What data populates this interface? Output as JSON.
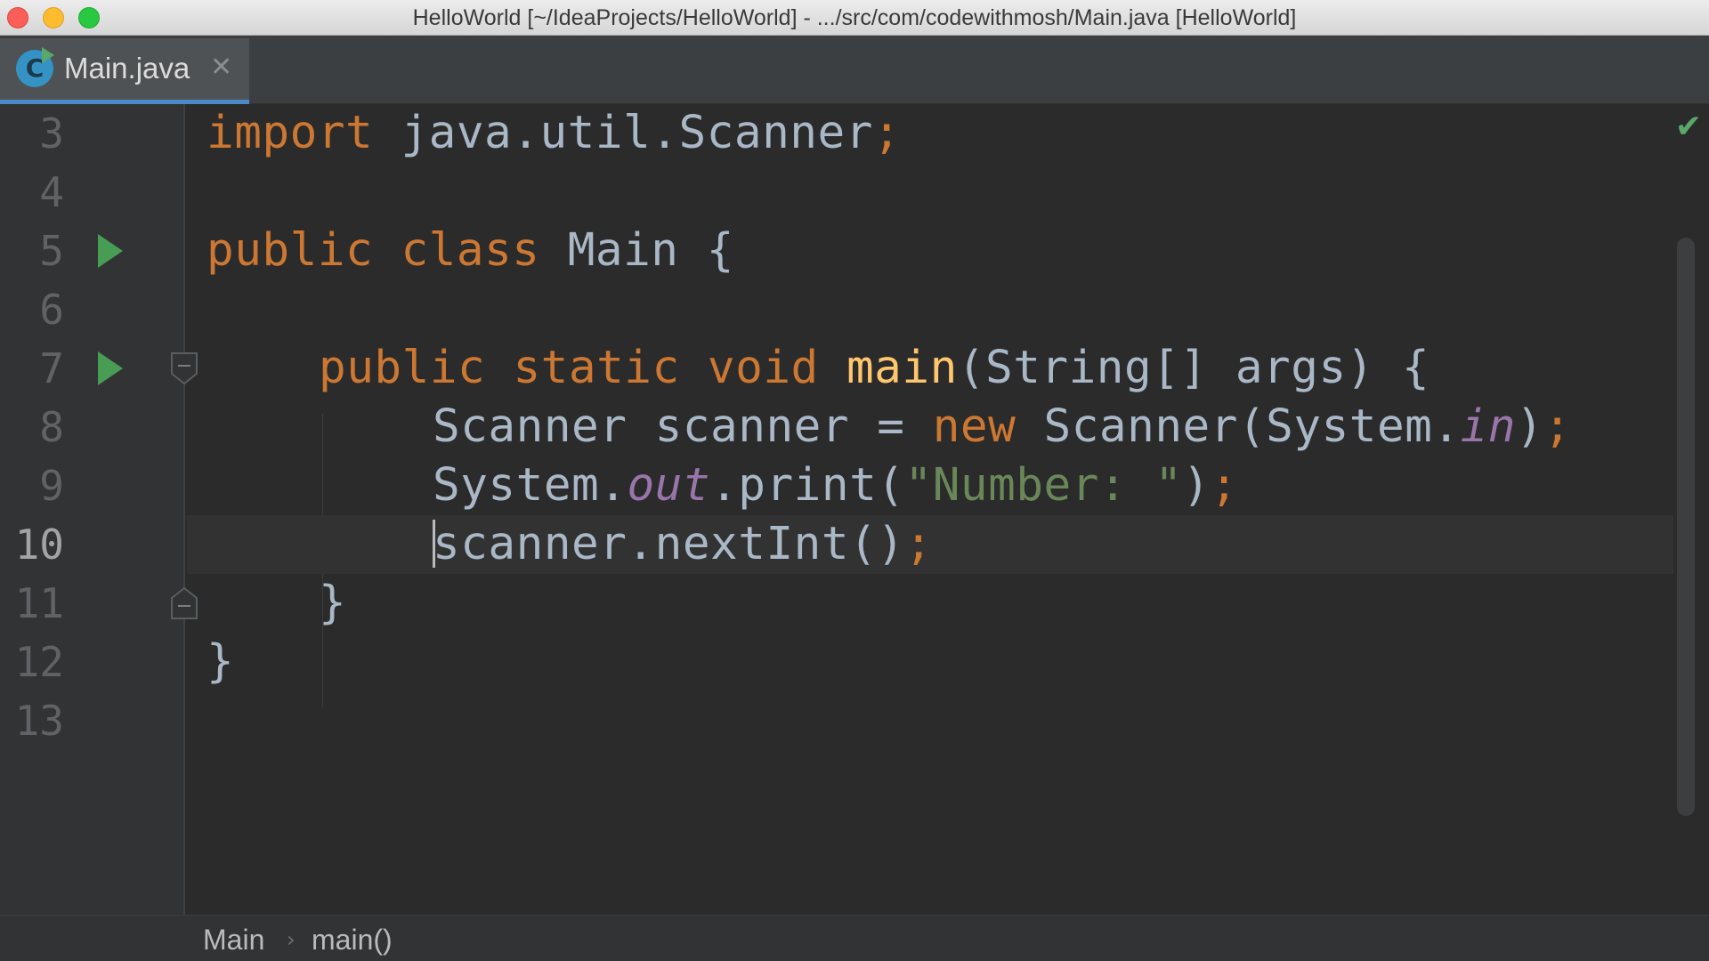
{
  "window": {
    "title": "HelloWorld [~/IdeaProjects/HelloWorld] - .../src/com/codewithmosh/Main.java [HelloWorld]"
  },
  "tabs": [
    {
      "label": "Main.java",
      "icon": "java-class-icon",
      "active": true
    }
  ],
  "editor": {
    "status_icon": "check-icon",
    "lines": [
      {
        "number": "3"
      },
      {
        "number": "4"
      },
      {
        "number": "5"
      },
      {
        "number": "6"
      },
      {
        "number": "7"
      },
      {
        "number": "8"
      },
      {
        "number": "9"
      },
      {
        "number": "10",
        "current": true
      },
      {
        "number": "11"
      },
      {
        "number": "12"
      },
      {
        "number": "13"
      }
    ],
    "tokens": {
      "l3": [
        "import",
        " java.util.Scanner",
        ";"
      ],
      "l5": [
        "public",
        " ",
        "class",
        " Main {"
      ],
      "l7": [
        "public",
        " ",
        "static",
        " ",
        "void",
        " ",
        "main",
        "(String[] args) {"
      ],
      "l8": [
        "Scanner scanner = ",
        "new",
        " Scanner(System.",
        "in",
        ")",
        ";"
      ],
      "l9": [
        "System.",
        "out",
        ".print(",
        "\"Number: \"",
        ")",
        ";"
      ],
      "l10": [
        "scanner.nextInt()",
        ";"
      ],
      "l11": [
        "}"
      ],
      "l12": [
        "}"
      ]
    }
  },
  "breadcrumbs": {
    "items": [
      "Main",
      "main()"
    ],
    "separator": "›"
  },
  "colors": {
    "keyword": "#cc7832",
    "method_decl": "#ffc66d",
    "string": "#6a8759",
    "static_field": "#9876aa",
    "default_text": "#a9b7c6",
    "background": "#2b2b2b"
  }
}
